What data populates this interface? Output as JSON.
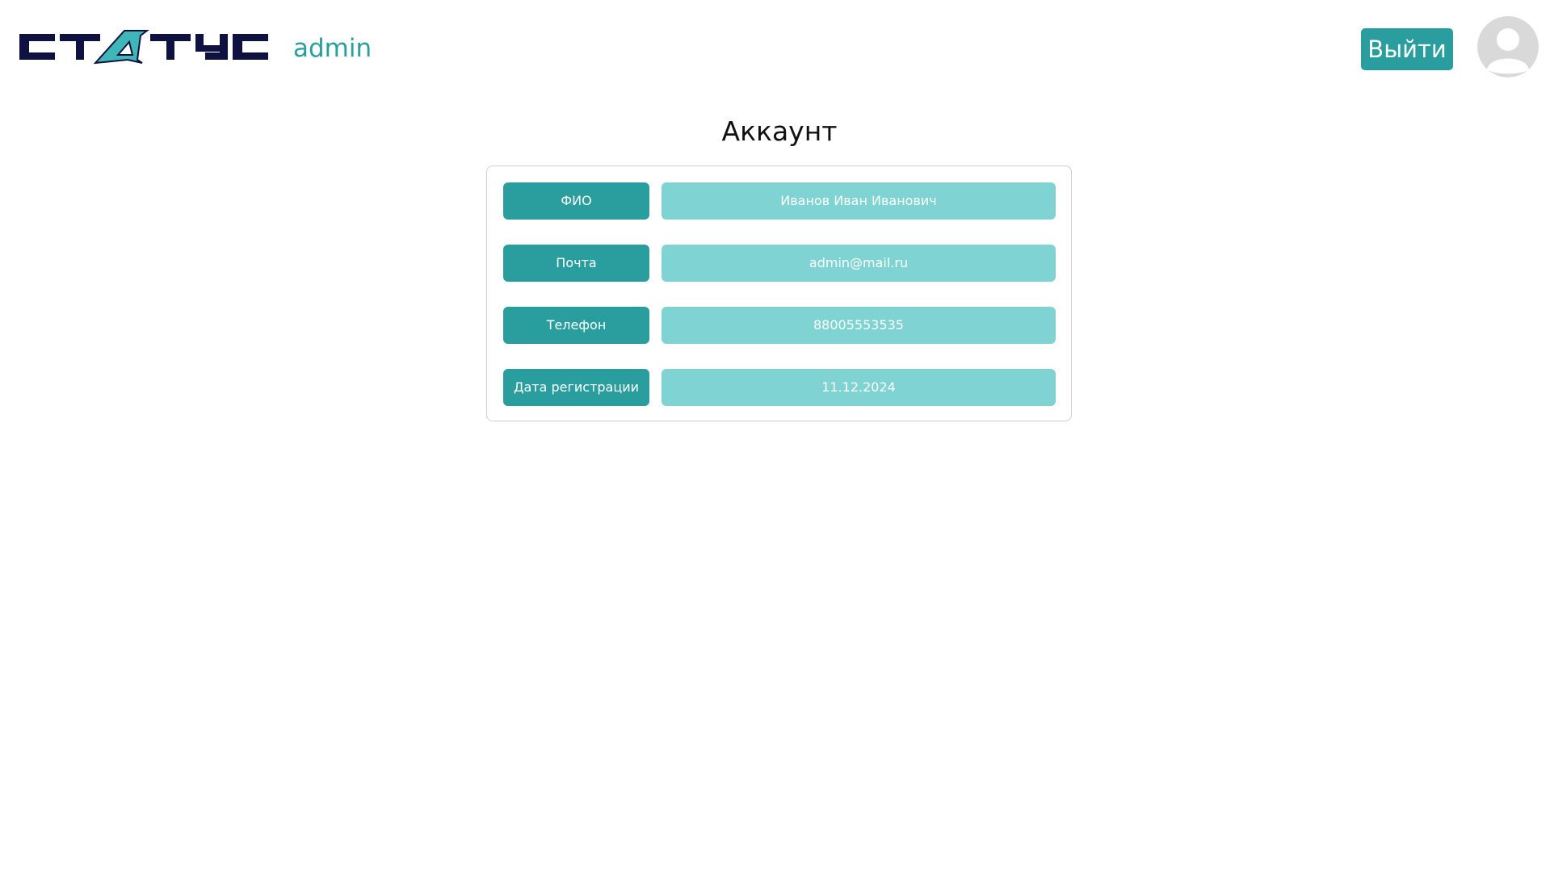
{
  "header": {
    "username": "admin",
    "logout_label": "Выйти",
    "brand_color": "#2a9d9f",
    "logo_color": "#0f1240"
  },
  "page": {
    "title": "Аккаунт"
  },
  "account": {
    "fields": [
      {
        "label": "ФИО",
        "value": "Иванов Иван Иванович"
      },
      {
        "label": "Почта",
        "value": "admin@mail.ru"
      },
      {
        "label": "Телефон",
        "value": "88005553535"
      },
      {
        "label": "Дата регистрации",
        "value": "11.12.2024"
      }
    ],
    "label_color": "#2a9d9f",
    "value_color": "#7fd3d2"
  }
}
